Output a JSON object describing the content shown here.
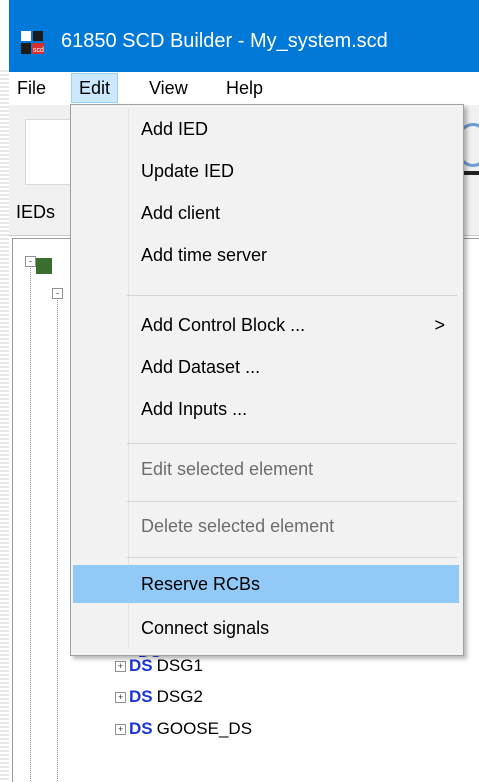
{
  "window": {
    "title": "61850 SCD Builder - My_system.scd",
    "app_icon": "scd-app-icon",
    "titlebar_color": "#0078d7"
  },
  "menubar": {
    "items": [
      {
        "label": "File"
      },
      {
        "label": "Edit"
      },
      {
        "label": "View"
      },
      {
        "label": "Help"
      }
    ],
    "active": "Edit"
  },
  "panel": {
    "tab_label": "IEDs"
  },
  "edit_menu": {
    "items": [
      {
        "label": "Add IED",
        "enabled": true
      },
      {
        "label": "Update IED",
        "enabled": true
      },
      {
        "label": "Add client",
        "enabled": true
      },
      {
        "label": "Add time server",
        "enabled": true
      },
      {
        "label": "Add Control Block ...",
        "enabled": true,
        "submenu": true,
        "arrow": ">"
      },
      {
        "label": "Add Dataset ...",
        "enabled": true
      },
      {
        "label": "Add Inputs ...",
        "enabled": true
      },
      {
        "label": "Edit selected element",
        "enabled": false
      },
      {
        "label": "Delete selected element",
        "enabled": false
      },
      {
        "label": "Reserve RCBs",
        "enabled": true,
        "highlighted": true
      },
      {
        "label": "Connect signals",
        "enabled": true
      }
    ],
    "highlight_color": "#91c9f7"
  },
  "tree": {
    "icon_label": "DS",
    "icon_color": "#1c36d6",
    "expander_symbol": "+",
    "rows": [
      {
        "name": "DSG1"
      },
      {
        "name": "DSG2"
      },
      {
        "name": "GOOSE_DS"
      }
    ]
  }
}
